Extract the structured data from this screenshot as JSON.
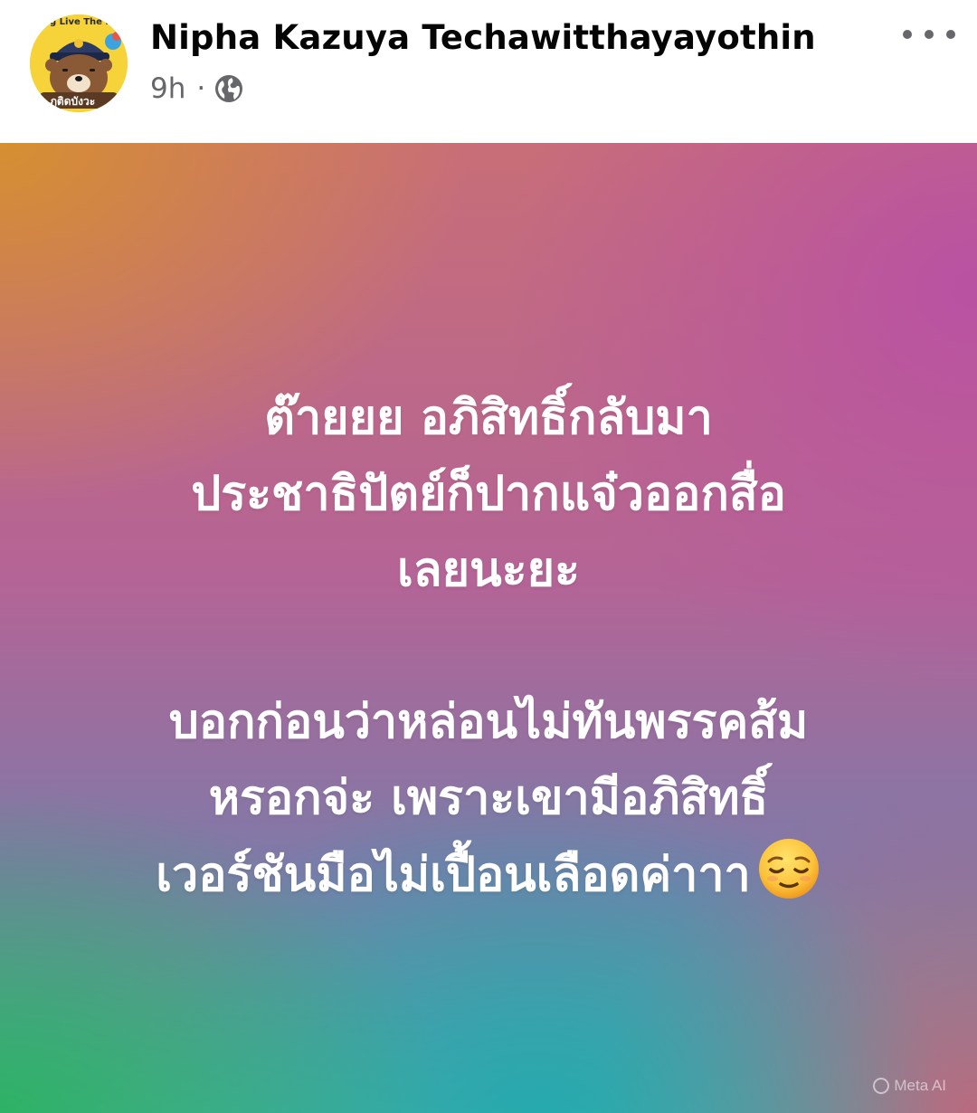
{
  "post": {
    "author": {
      "name": "Nipha Kazuya Techawitthayayothin",
      "avatar": {
        "icon": "bear-pilot-avatar",
        "caption_top": "g Live The K",
        "caption_bottom": "ภูติดบังวะ"
      }
    },
    "meta": {
      "time": "9h",
      "separator": "·",
      "audience_icon": "globe-icon"
    },
    "more_icon": "more-horizontal-icon",
    "text_lines": [
      "ต๊ายยย อภิสิทธิ์กลับมา",
      "ประชาธิปัตย์ก็ปากแจ๋วออกสื่อ",
      "เลยนะยะ",
      "",
      "บอกก่อนว่าหล่อนไม่ทันพรรคส้ม",
      "หรอกจ่ะ เพราะเขามีอภิสิทธิ์",
      "เวอร์ชันมือไม่เปื้อนเลือดค่าาา"
    ],
    "emoji": "relieved-face-emoji",
    "watermark": "Meta AI",
    "colors": {
      "name": "#050505",
      "meta": "#65676b",
      "text": "#ffffff",
      "gradient_top_left": "#d7912d",
      "gradient_top_right": "#b950a5",
      "gradient_bottom_left": "#28b45a",
      "gradient_bottom_center": "#1eaaaf",
      "gradient_bottom_right": "#cd5f78"
    }
  }
}
